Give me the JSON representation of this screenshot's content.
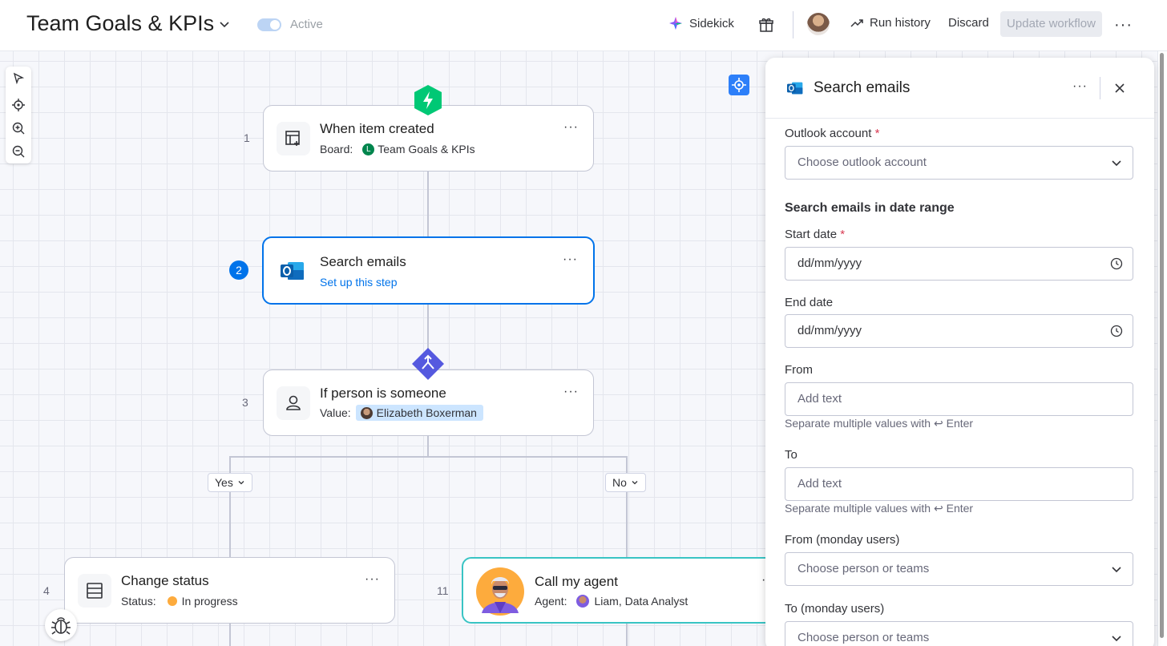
{
  "header": {
    "title": "Team Goals & KPIs",
    "active_label": "Active",
    "sidekick_label": "Sidekick",
    "run_history_label": "Run history",
    "discard_label": "Discard",
    "update_workflow_label": "Update workflow",
    "more_label": "···"
  },
  "nodes": {
    "trigger": {
      "step": "1",
      "title": "When item created",
      "board_label": "Board:",
      "board_badge": "L",
      "board_value": "Team Goals & KPIs",
      "more": "···"
    },
    "search": {
      "step": "2",
      "title": "Search emails",
      "link": "Set up this step",
      "more": "···"
    },
    "condition": {
      "step": "3",
      "title": "If person is someone",
      "value_label": "Value:",
      "value": "Elizabeth Boxerman",
      "more": "···"
    },
    "status": {
      "step": "4",
      "title": "Change status",
      "status_label": "Status:",
      "status_value": "In progress",
      "status_color": "#fdab3d",
      "more": "···"
    },
    "agent": {
      "step": "11",
      "title": "Call my agent",
      "agent_label": "Agent:",
      "agent_value": "Liam, Data Analyst",
      "more": "···"
    }
  },
  "branches": {
    "yes": "Yes",
    "no": "No"
  },
  "panel": {
    "title": "Search emails",
    "more": "···",
    "outlook_label": "Outlook account",
    "required_mark": "*",
    "outlook_placeholder": "Choose outlook account",
    "date_section": "Search emails in date range",
    "start_label": "Start date",
    "start_placeholder": "dd/mm/yyyy",
    "end_label": "End date",
    "end_placeholder": "dd/mm/yyyy",
    "from_label": "From",
    "from_placeholder": "Add text",
    "from_hint": "Separate multiple values with ↩ Enter",
    "to_label": "To",
    "to_placeholder": "Add text",
    "to_hint": "Separate multiple values with ↩ Enter",
    "from_users_label": "From (monday users)",
    "from_users_placeholder": "Choose person or teams",
    "to_users_label": "To (monday users)",
    "to_users_placeholder": "Choose person or teams"
  },
  "colors": {
    "accent": "#0073ea",
    "trigger_green": "#00c875",
    "condition_purple": "#5559df",
    "agent_teal": "#39c4c4",
    "outlook_blue": "#0f6cbd"
  }
}
